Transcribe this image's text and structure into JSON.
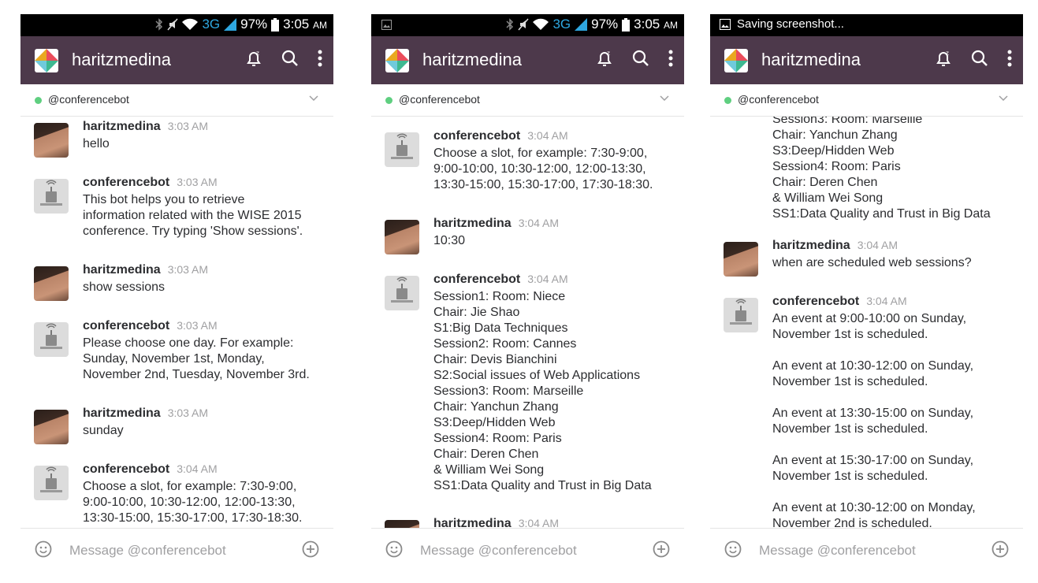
{
  "status": {
    "battery": "97%",
    "time": "3:05",
    "ampm": "AM",
    "network": "3G",
    "saving": "Saving screenshot..."
  },
  "app": {
    "team_name": "haritzmedina"
  },
  "channel": {
    "name": "@conferencebot"
  },
  "composer": {
    "placeholder": "Message @conferencebot"
  },
  "colors": {
    "appbar": "#4d394b",
    "presence": "#5fcf80",
    "network": "#2ea7e0"
  },
  "icons": [
    "snooze-icon",
    "search-icon",
    "more-vert-icon",
    "chevron-down-icon",
    "emoji-icon",
    "plus-circle-icon"
  ],
  "phones": [
    {
      "messages": [
        {
          "sender": "haritzmedina",
          "time": "3:03 AM",
          "text": "hello",
          "avatar": "user"
        },
        {
          "sender": "conferencebot",
          "time": "3:03 AM",
          "text": "This bot helps you to retrieve\ninformation related with the WISE 2015\nconference. Try typing 'Show sessions'.",
          "avatar": "bot"
        },
        {
          "sender": "haritzmedina",
          "time": "3:03 AM",
          "text": "show sessions",
          "avatar": "user"
        },
        {
          "sender": "conferencebot",
          "time": "3:03 AM",
          "text": "Please choose one day. For example:\nSunday, November 1st, Monday,\nNovember 2nd, Tuesday, November 3rd.",
          "avatar": "bot"
        },
        {
          "sender": "haritzmedina",
          "time": "3:03 AM",
          "text": "sunday",
          "avatar": "user"
        },
        {
          "sender": "conferencebot",
          "time": "3:04 AM",
          "text": "Choose a slot, for example: 7:30-9:00,\n9:00-10:00, 10:30-12:00, 12:00-13:30,\n13:30-15:00, 15:30-17:00, 17:30-18:30.",
          "avatar": "bot"
        }
      ]
    },
    {
      "messages": [
        {
          "sender": "conferencebot",
          "time": "3:04 AM",
          "text": "Choose a slot, for example: 7:30-9:00,\n9:00-10:00, 10:30-12:00, 12:00-13:30,\n13:30-15:00, 15:30-17:00, 17:30-18:30.",
          "avatar": "bot"
        },
        {
          "sender": "haritzmedina",
          "time": "3:04 AM",
          "text": "10:30",
          "avatar": "user"
        },
        {
          "sender": "conferencebot",
          "time": "3:04 AM",
          "text": "Session1: Room: Niece\nChair: Jie Shao\nS1:Big Data Techniques\nSession2: Room: Cannes\nChair: Devis Bianchini\nS2:Social issues of Web Applications\nSession3: Room: Marseille\nChair: Yanchun Zhang\nS3:Deep/Hidden Web\nSession4: Room: Paris\nChair: Deren Chen\n& William Wei Song\nSS1:Data Quality and Trust in Big Data",
          "avatar": "bot"
        },
        {
          "sender": "haritzmedina",
          "time": "3:04 AM",
          "text": "",
          "avatar": "user"
        }
      ]
    },
    {
      "messages": [
        {
          "sender": "",
          "time": "",
          "text": "Session3: Room: Marseille\nChair: Yanchun Zhang\nS3:Deep/Hidden Web\nSession4: Room: Paris\nChair: Deren Chen\n& William Wei Song\nSS1:Data Quality and Trust in Big Data",
          "avatar": ""
        },
        {
          "sender": "haritzmedina",
          "time": "3:04 AM",
          "text": "when are scheduled web sessions?",
          "avatar": "user"
        },
        {
          "sender": "conferencebot",
          "time": "3:04 AM",
          "text": "An event at 9:00-10:00 on Sunday,\nNovember 1st is scheduled.\n\nAn event at 10:30-12:00 on Sunday,\nNovember 1st is scheduled.\n\nAn event at 13:30-15:00 on Sunday,\nNovember 1st is scheduled.\n\nAn event at 15:30-17:00 on Sunday,\nNovember 1st is scheduled.\n\nAn event at 10:30-12:00 on Monday,\nNovember 2nd is scheduled.",
          "avatar": "bot"
        }
      ]
    }
  ]
}
